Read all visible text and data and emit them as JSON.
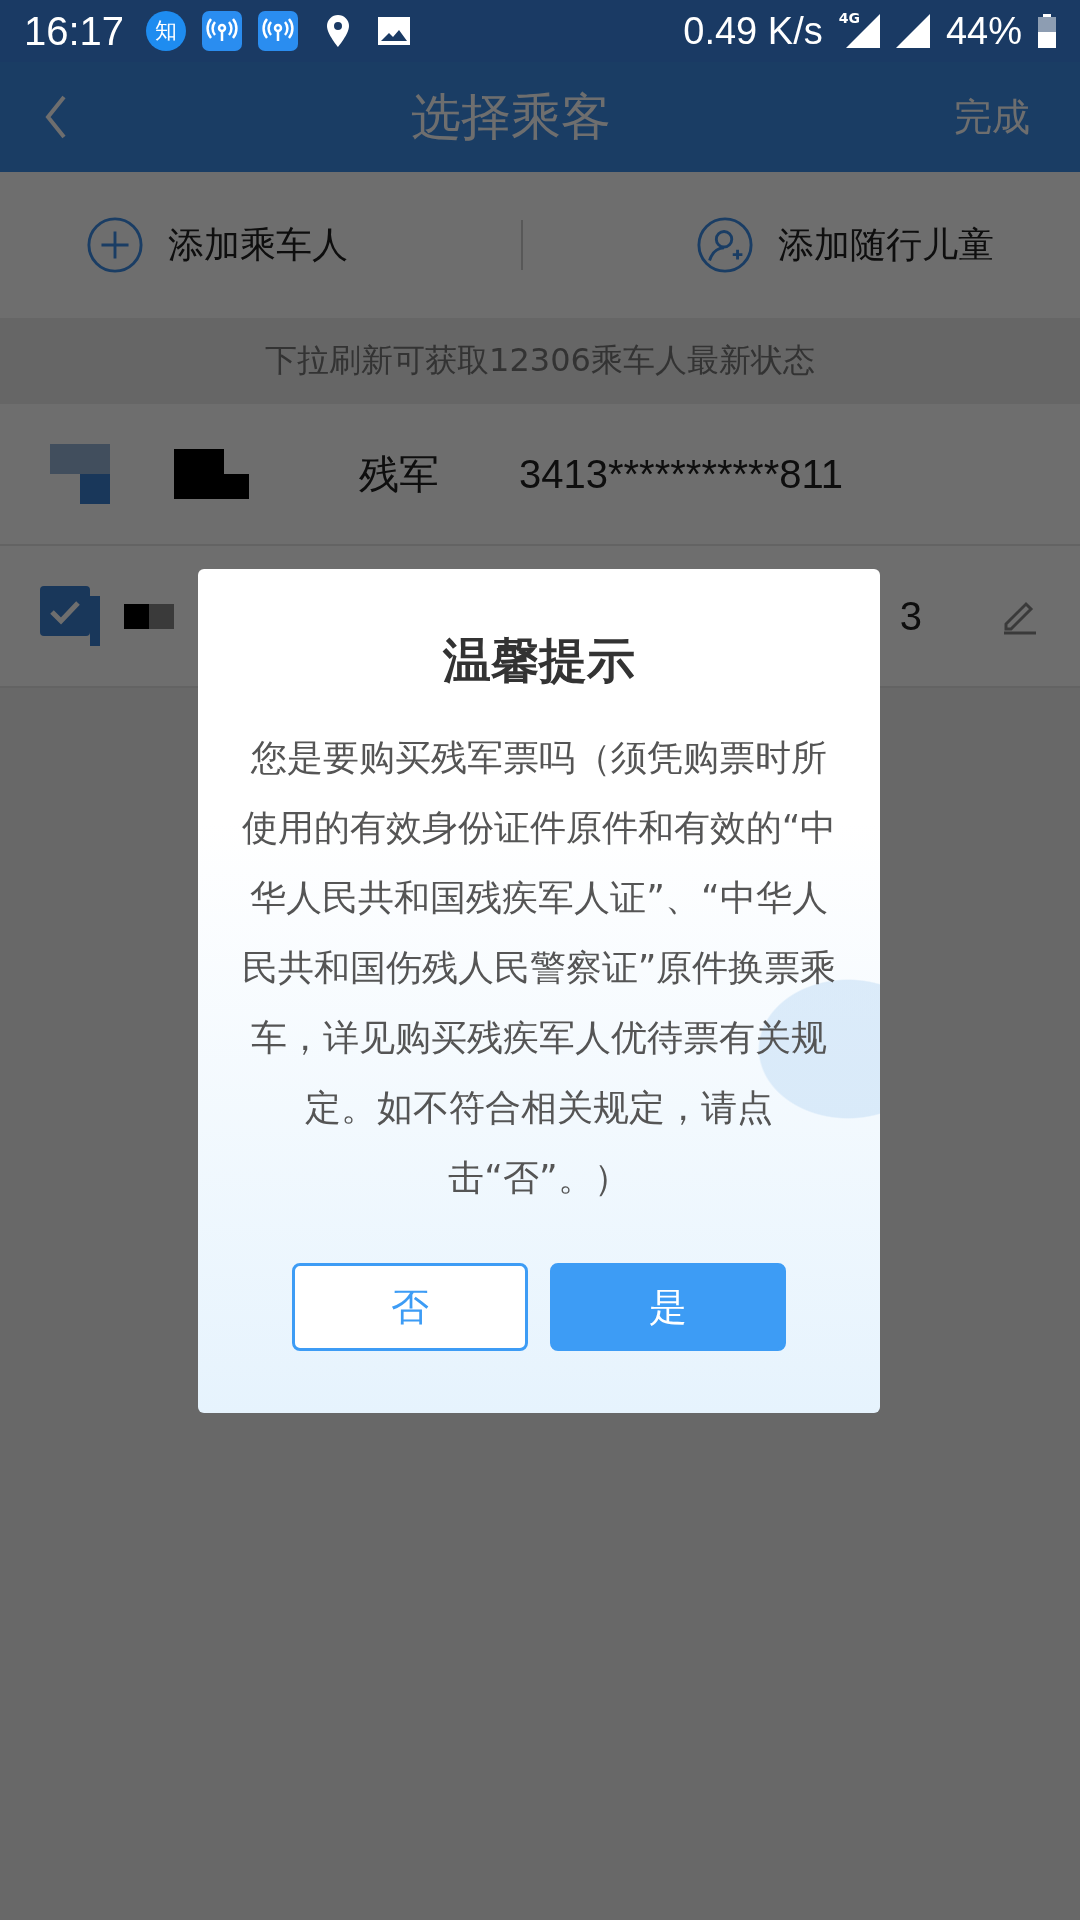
{
  "status_bar": {
    "time": "16:17",
    "app_badge": "知",
    "speed": "0.49 K/s",
    "network": "4G",
    "battery": "44%"
  },
  "header": {
    "title": "选择乘客",
    "done": "完成"
  },
  "actions": [
    {
      "label": "添加乘车人",
      "kind": "plus"
    },
    {
      "label": "添加随行儿童",
      "kind": "person"
    }
  ],
  "notice": "下拉刷新可获取12306乘车人最新状态",
  "passengers": [
    {
      "kind": "mosaic",
      "type": "残军",
      "id": "3413***********811"
    },
    {
      "kind": "checkbox",
      "checked": true,
      "id": "3"
    }
  ],
  "dialog": {
    "title": "温馨提示",
    "message": "您是要购买残军票吗（须凭购票时所使用的有效身份证件原件和有效的“中华人民共和国残疾军人证”、“中华人民共和国伤残人民警察证”原件换票乘车，详见购买残疾军人优待票有关规定。如不符合相关规定，请点击“否”。）",
    "buttons": [
      {
        "label": "否",
        "primary": false
      },
      {
        "label": "是",
        "primary": true
      }
    ]
  }
}
